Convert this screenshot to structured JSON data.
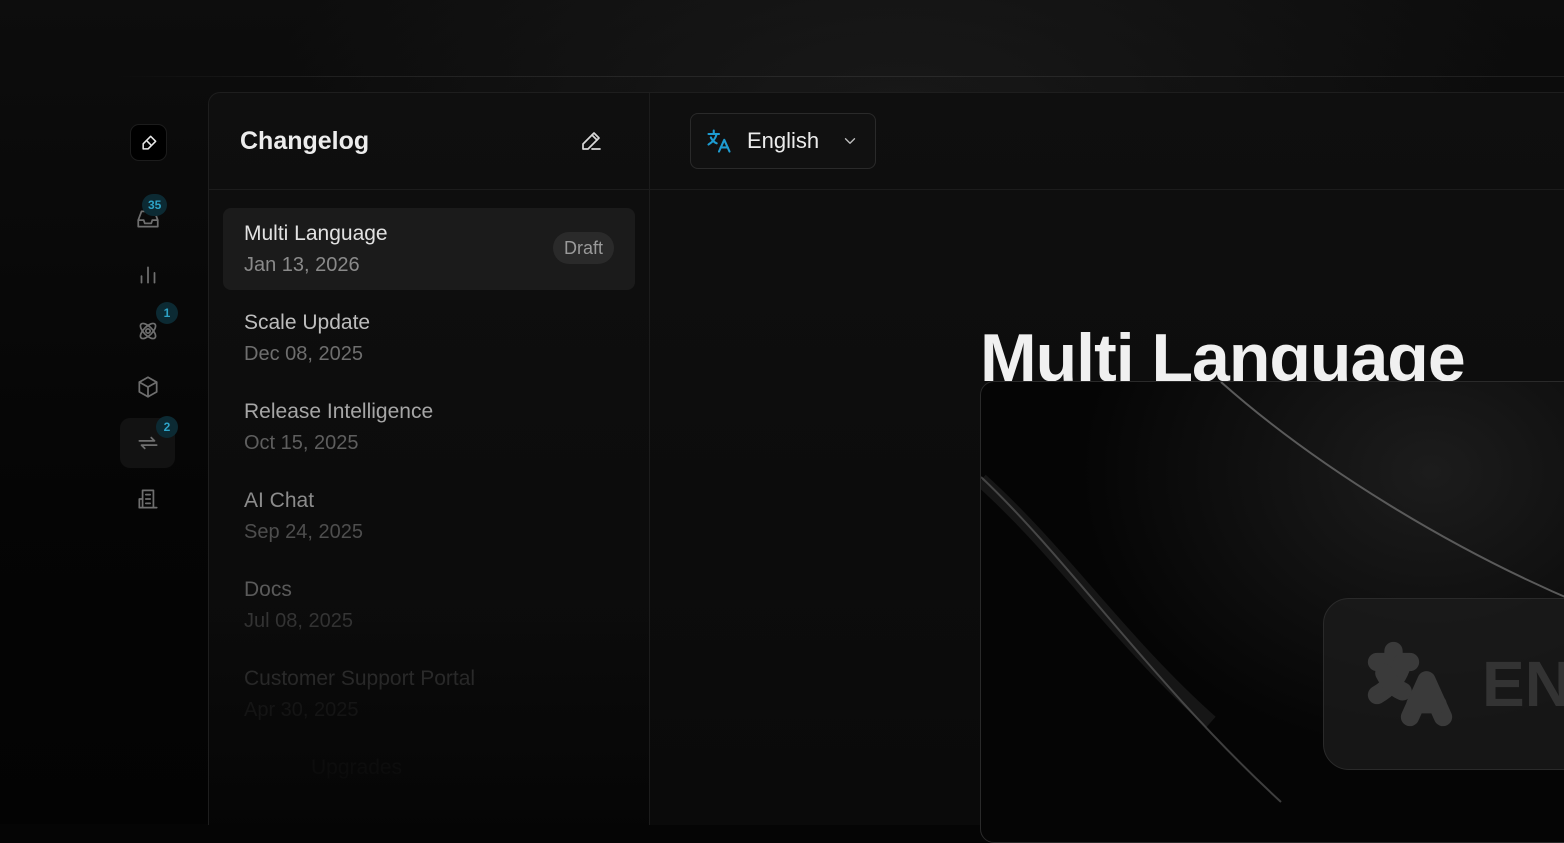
{
  "rail": {
    "badges": {
      "inbox": "35",
      "integrations": "1",
      "changelog": "2"
    }
  },
  "list": {
    "title": "Changelog",
    "entries": [
      {
        "title": "Multi Language",
        "date": "Jan 13, 2026",
        "status": "Draft"
      },
      {
        "title": "Scale Update",
        "date": "Dec 08, 2025"
      },
      {
        "title": "Release Intelligence",
        "date": "Oct 15, 2025"
      },
      {
        "title": "AI Chat",
        "date": "Sep 24, 2025"
      },
      {
        "title": "Docs",
        "date": "Jul 08, 2025"
      },
      {
        "title": "Customer Support Portal",
        "date": "Apr 30, 2025"
      },
      {
        "title": "Upgrades",
        "date": ""
      }
    ]
  },
  "content": {
    "language": "English",
    "post_title": "Multi Language",
    "hero_chip_text": "EN"
  },
  "colors": {
    "accent": "#1e9cd1",
    "badge_bg": "#0c2a33",
    "badge_text": "#2ea3c7"
  },
  "icons": [
    "logo-icon",
    "inbox-icon",
    "chart-icon",
    "integrations-icon",
    "box-icon",
    "changelog-icon",
    "building-icon",
    "edit-icon",
    "translate-icon",
    "chevron-down-icon"
  ]
}
